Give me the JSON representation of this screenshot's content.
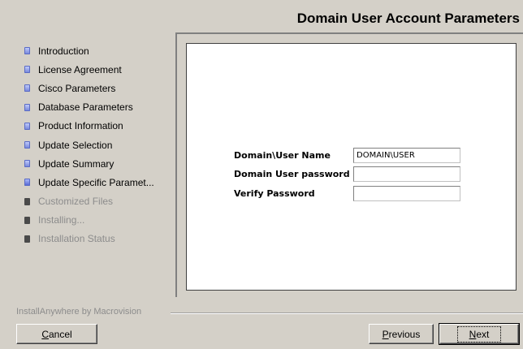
{
  "header": {
    "title": "Domain User Account Parameters"
  },
  "sidebar": {
    "steps": [
      {
        "label": "Introduction",
        "state": "done"
      },
      {
        "label": "License Agreement",
        "state": "done"
      },
      {
        "label": "Cisco Parameters",
        "state": "done"
      },
      {
        "label": "Database Parameters",
        "state": "done"
      },
      {
        "label": "Product Information",
        "state": "done"
      },
      {
        "label": "Update Selection",
        "state": "done"
      },
      {
        "label": "Update Summary",
        "state": "done"
      },
      {
        "label": "Update Specific Paramet...",
        "state": "active"
      },
      {
        "label": "Customized Files",
        "state": "pending"
      },
      {
        "label": "Installing...",
        "state": "pending"
      },
      {
        "label": "Installation Status",
        "state": "pending"
      }
    ]
  },
  "form": {
    "username_label": "Domain\\User Name",
    "username_value": "DOMAIN\\USER",
    "password_label": "Domain User password",
    "password_value": "",
    "verify_label": "Verify Password",
    "verify_value": ""
  },
  "footer": {
    "brand": "InstallAnywhere by Macrovision",
    "cancel_label_prefix": "",
    "cancel_mnemonic": "C",
    "cancel_label_rest": "ancel",
    "previous_mnemonic": "P",
    "previous_label_rest": "revious",
    "next_mnemonic": "N",
    "next_label_rest": "ext"
  }
}
